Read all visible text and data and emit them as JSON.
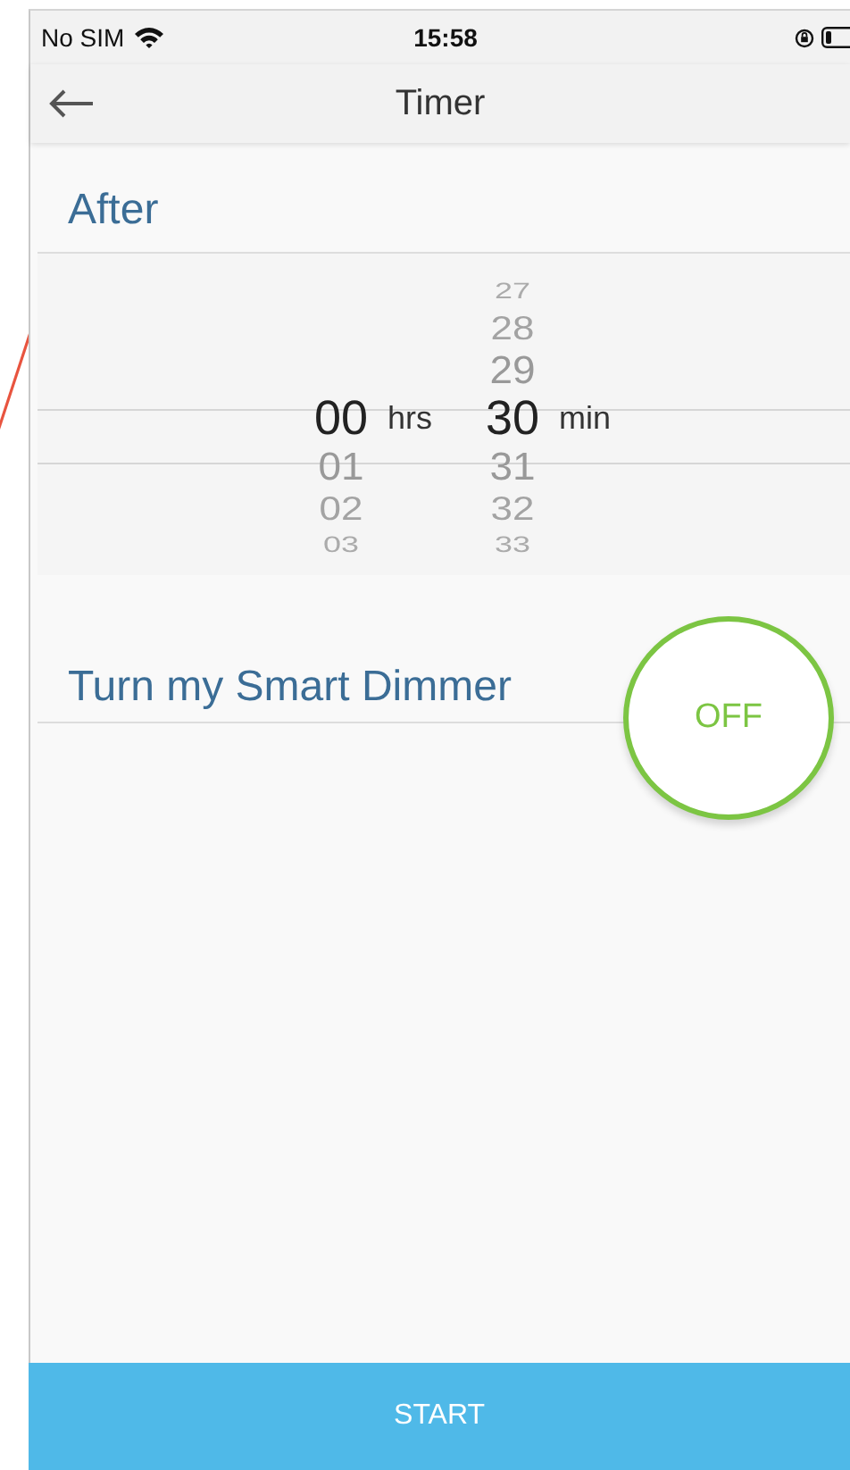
{
  "status_bar": {
    "carrier": "No SIM",
    "time": "15:58"
  },
  "nav": {
    "title": "Timer"
  },
  "after": {
    "label": "After"
  },
  "picker": {
    "columns": [
      {
        "unit": "hrs",
        "items": [
          {
            "value": "00",
            "selected": true
          },
          {
            "value": "01",
            "selected": false
          },
          {
            "value": "02",
            "selected": false
          },
          {
            "value": "03",
            "selected": false
          }
        ]
      },
      {
        "unit": "min",
        "items": [
          {
            "value": "27",
            "selected": false
          },
          {
            "value": "28",
            "selected": false
          },
          {
            "value": "29",
            "selected": false
          },
          {
            "value": "30",
            "selected": true
          },
          {
            "value": "31",
            "selected": false
          },
          {
            "value": "32",
            "selected": false
          },
          {
            "value": "33",
            "selected": false
          }
        ]
      }
    ]
  },
  "action": {
    "label": "Turn my Smart Dimmer",
    "toggle": {
      "label": "OFF",
      "on": false
    }
  },
  "start_button": {
    "label": "START"
  }
}
